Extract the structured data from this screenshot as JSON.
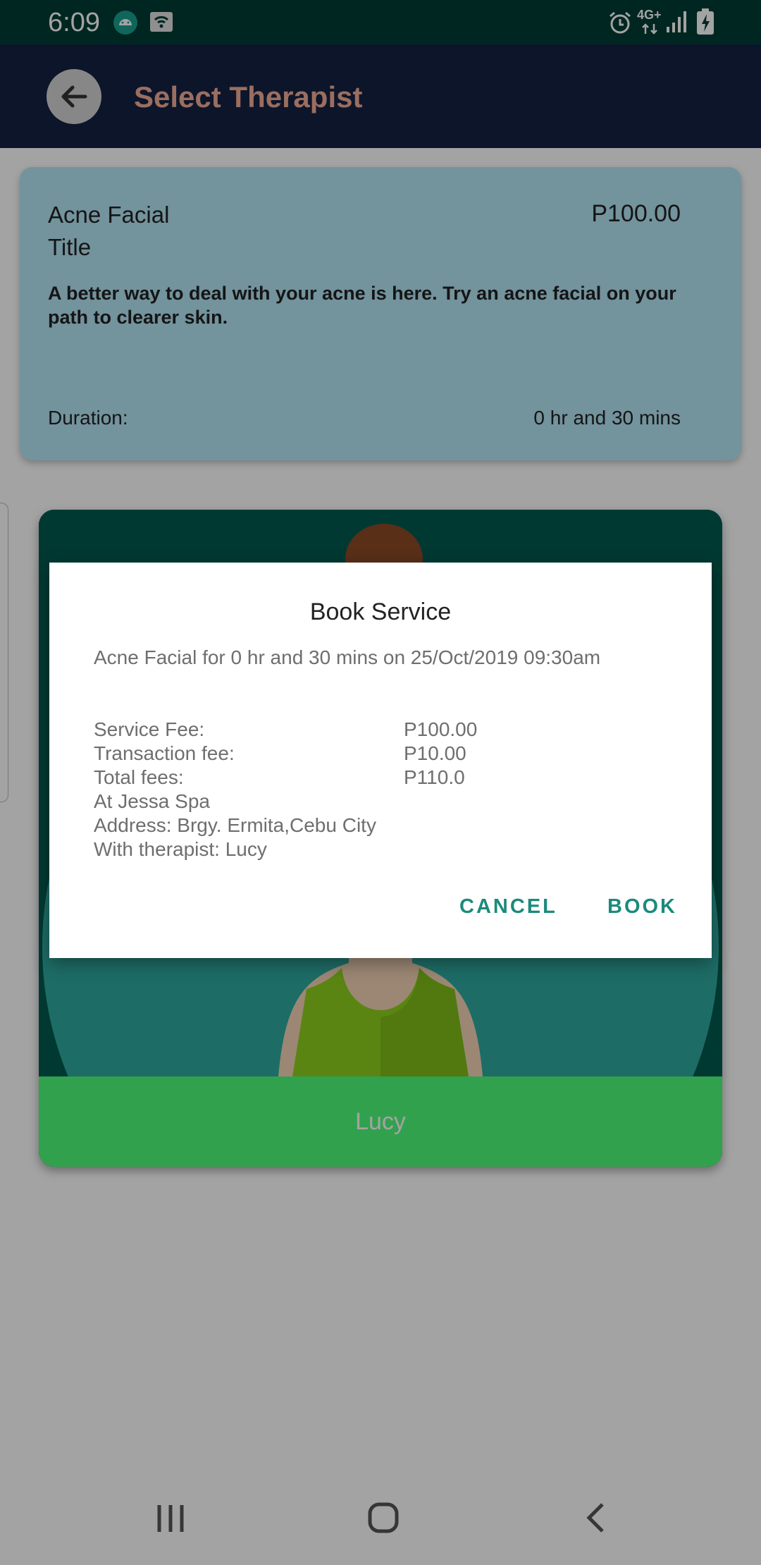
{
  "status_bar": {
    "time": "6:09",
    "network": "4G+"
  },
  "app_bar": {
    "title": "Select Therapist"
  },
  "service": {
    "name": "Acne Facial",
    "price": "P100.00",
    "subtitle": "Title",
    "description": "A better way to deal with your acne is here. Try an acne facial on your path to clearer skin.",
    "duration_label": "Duration:",
    "duration_value": "0 hr and 30 mins"
  },
  "therapist": {
    "name": "Lucy"
  },
  "dialog": {
    "title": "Book Service",
    "summary": "Acne Facial for 0 hr and 30 mins on 25/Oct/2019 09:30am",
    "service_fee_label": "Service Fee:",
    "service_fee_value": "P100.00",
    "transaction_fee_label": "Transaction fee:",
    "transaction_fee_value": "P10.00",
    "total_fees_label": "Total fees:",
    "total_fees_value": "P110.0",
    "location": "At Jessa Spa",
    "address": "Address: Brgy. Ermita,Cebu City",
    "therapist_line": "With therapist: Lucy",
    "cancel_label": "CANCEL",
    "book_label": "BOOK"
  },
  "colors": {
    "status_bar": "#003c34",
    "app_bar": "#142242",
    "title_text": "#f2ac95",
    "service_card": "#b5e7f6",
    "name_bar": "#4ffc7a",
    "dialog_button": "#1c8a7c"
  }
}
